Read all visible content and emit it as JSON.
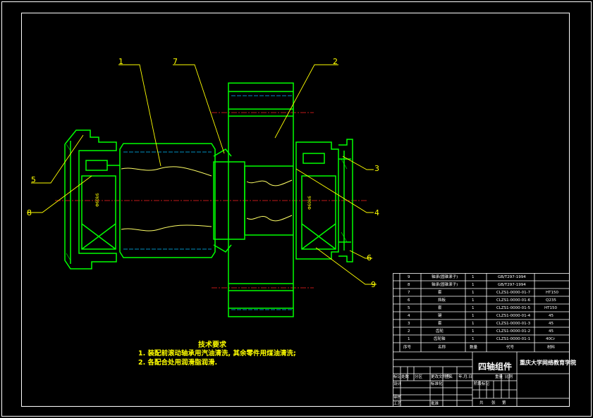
{
  "callouts": [
    "1",
    "7",
    "2",
    "3",
    "4",
    "5",
    "8",
    "6",
    "9"
  ],
  "tech": {
    "title": "技术要求",
    "line1": "1. 装配前滚动轴承用汽油清洗, 其余零件用煤油清洗;",
    "line2": "2. 各配合处用润滑脂润滑."
  },
  "title_block": {
    "drawing_name": "四轴组件",
    "school": "重庆大学网络教育学院",
    "header": {
      "seq": "序号",
      "name": "名称",
      "qty": "数量",
      "code": "代号",
      "note": "材料"
    },
    "rows": [
      {
        "seq": "9",
        "name": "轴承(圆锥滚子)",
        "qty": "1",
        "code": "GB/T297-1994",
        "note": ""
      },
      {
        "seq": "8",
        "name": "轴承(圆锥滚子)",
        "qty": "1",
        "code": "GB/T297-1994",
        "note": ""
      },
      {
        "seq": "7",
        "name": "套",
        "qty": "1",
        "code": "CLZS1-0000-01-7",
        "note": "HT150"
      },
      {
        "seq": "6",
        "name": "挡板",
        "qty": "1",
        "code": "CLZS1-0000-01-6",
        "note": "Q235"
      },
      {
        "seq": "5",
        "name": "套",
        "qty": "1",
        "code": "CLZS1-0000-01-5",
        "note": "HT150"
      },
      {
        "seq": "4",
        "name": "键",
        "qty": "1",
        "code": "CLZS1-0000-01-4",
        "note": "45"
      },
      {
        "seq": "3",
        "name": "套",
        "qty": "1",
        "code": "CLZS1-0000-01-3",
        "note": "45"
      },
      {
        "seq": "2",
        "name": "齿轮",
        "qty": "1",
        "code": "CLZS1-0000-01-2",
        "note": "45"
      },
      {
        "seq": "1",
        "name": "齿轮轴",
        "qty": "1",
        "code": "CLZS1-0000-01-1",
        "note": "40Cr"
      }
    ],
    "labels": {
      "biaoji": "标记",
      "chushu": "处数",
      "fenqu": "分区",
      "gengai": "更改文件号",
      "qianming": "签名",
      "riqi": "年.月.日",
      "sheji": "设计",
      "biaozhunhua": "标准化",
      "jieduan": "阶段标记",
      "zhongliang": "重量",
      "bili": "比例",
      "shenhe": "审核",
      "gongyi": "工艺",
      "pizhun": "批准",
      "gong": "共",
      "zhang": "张",
      "di": "第"
    }
  }
}
